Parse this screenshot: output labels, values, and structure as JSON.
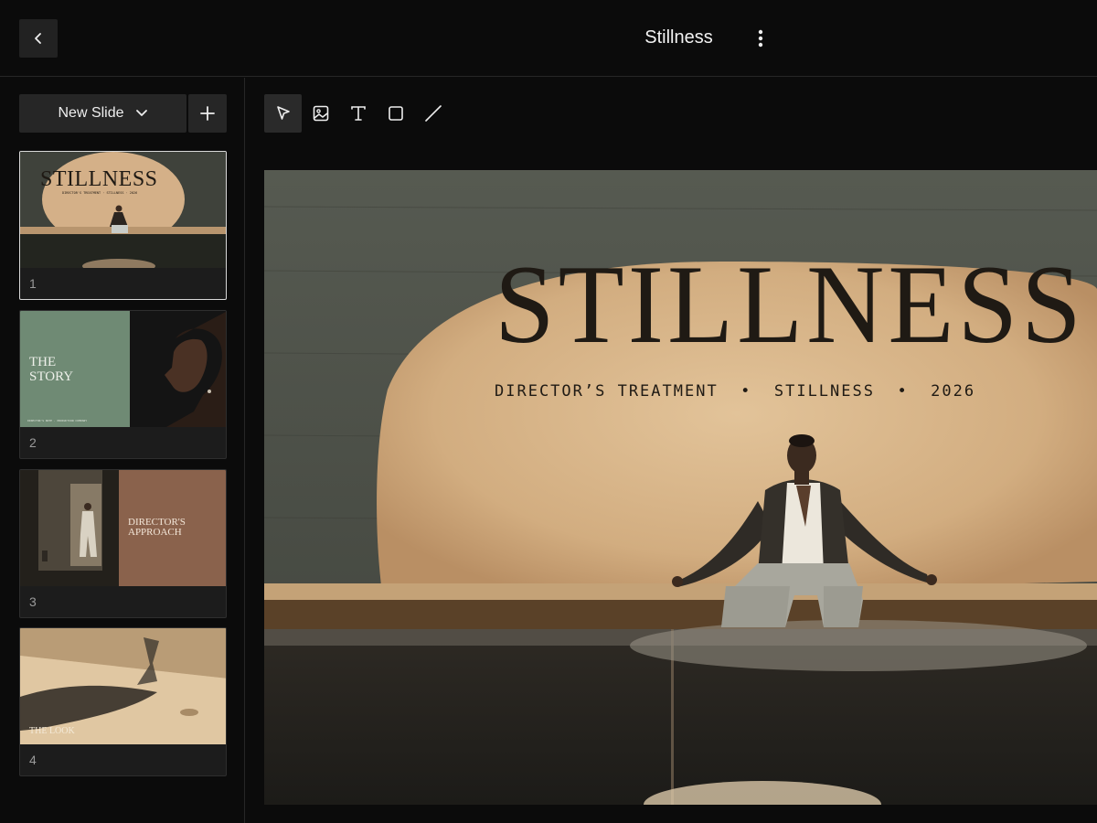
{
  "header": {
    "title": "Stillness",
    "back_icon": "chevron-left-icon",
    "more_icon": "more-vertical-icon"
  },
  "sidebar": {
    "new_slide_label": "New Slide",
    "add_icon": "plus-icon",
    "slides": [
      {
        "number": "1",
        "title": "STILLNESS",
        "subtitle": "DIRECTOR'S TREATMENT · STILLNESS · 2026"
      },
      {
        "number": "2",
        "title": "THE STORY",
        "footer": "DIRECTOR'S NOTE · PRODUCTION COMPANY"
      },
      {
        "number": "3",
        "title": "DIRECTOR'S APPROACH"
      },
      {
        "number": "4",
        "title": "THE LOOK"
      }
    ]
  },
  "toolbar": {
    "tools": [
      "select-tool",
      "image-tool",
      "text-tool",
      "rectangle-tool",
      "line-tool"
    ],
    "active": "select-tool"
  },
  "slide": {
    "title": "STILLNESS",
    "subtitle": "DIRECTOR’S TREATMENT  •  STILLNESS  •  2026"
  },
  "colors": {
    "background": "#0b0b0b",
    "panel": "#262626",
    "text": "#f2f2f2",
    "sand": "#d8b58a",
    "sage": "#6f8a74",
    "clay": "#8a624c"
  }
}
